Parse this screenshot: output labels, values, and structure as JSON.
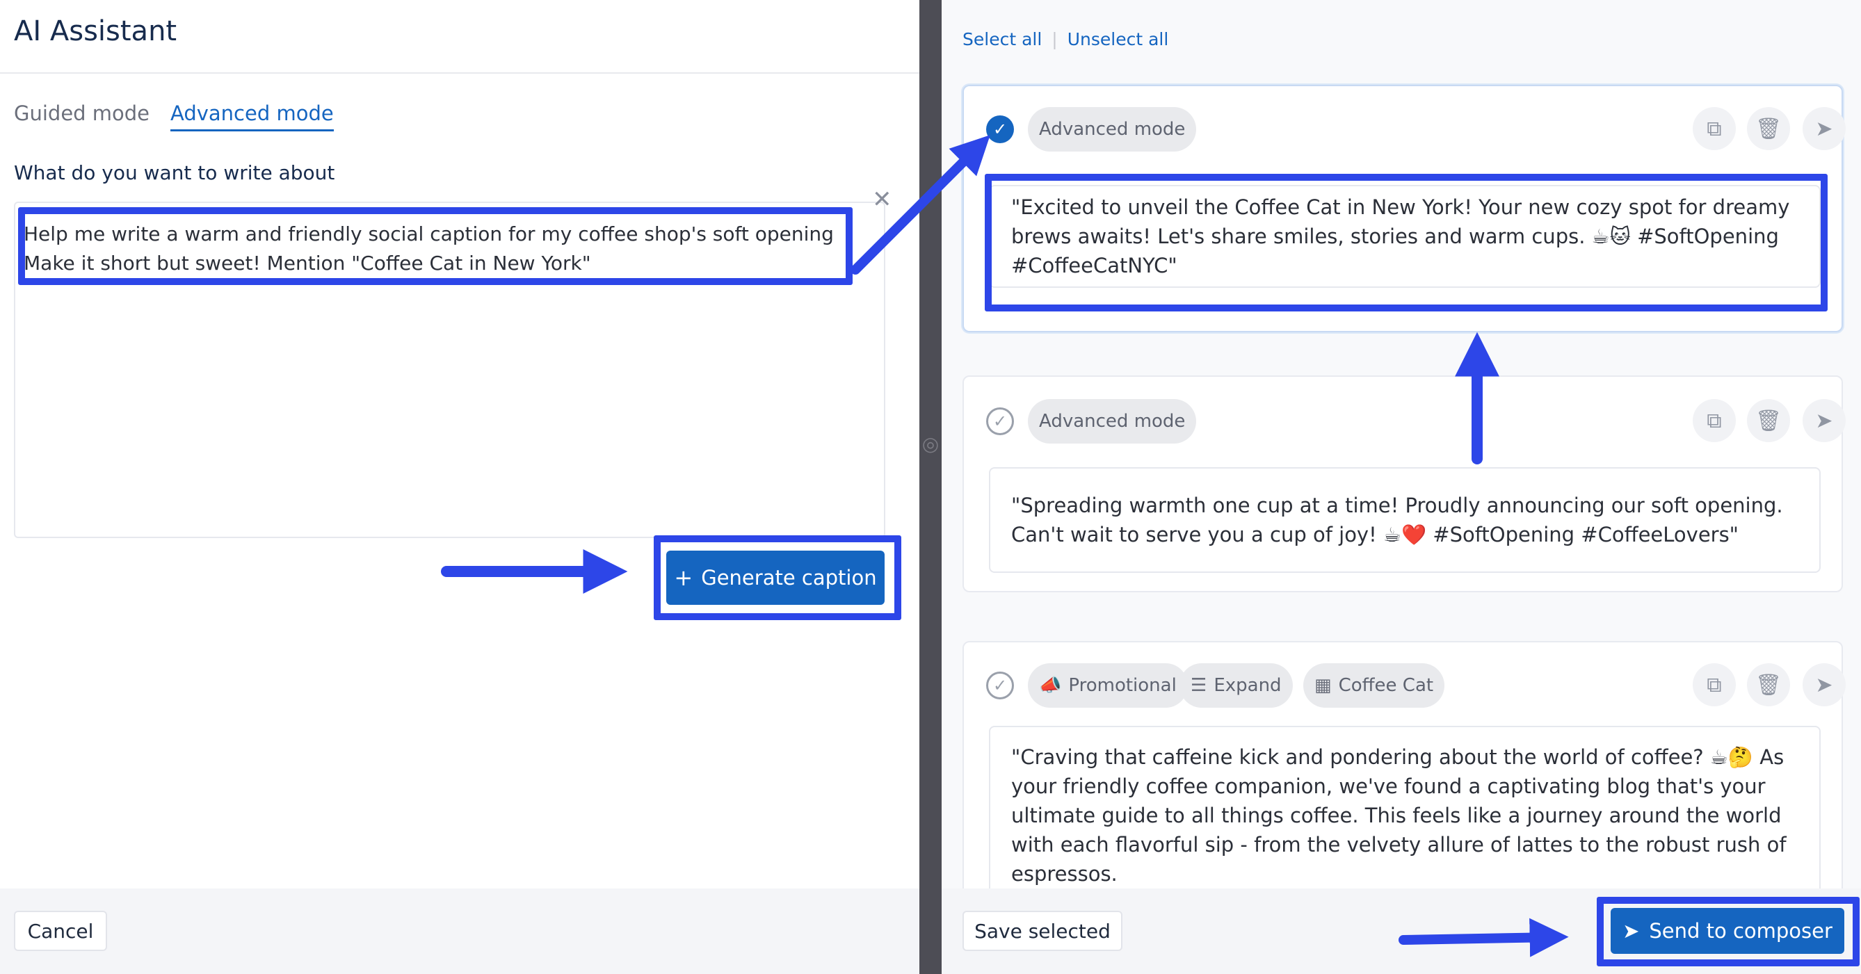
{
  "left": {
    "title": "AI Assistant",
    "tabs": [
      {
        "label": "Guided mode",
        "active": false
      },
      {
        "label": "Advanced mode",
        "active": true
      }
    ],
    "prompt_label": "What do you want to write about",
    "prompt_value": "Help me write a warm and friendly social caption for my coffee shop's soft opening Make it short but sweet! Mention \"Coffee Cat in New York\"",
    "generate_label": "Generate caption",
    "cancel_label": "Cancel"
  },
  "right": {
    "select_all": "Select all",
    "unselect_all": "Unselect all",
    "cards": [
      {
        "selected": true,
        "chips": [
          "Advanced mode"
        ],
        "caption": "\"Excited to unveil the Coffee Cat in New York! Your new cozy spot for dreamy brews awaits! Let's share smiles, stories and warm cups. ☕🐱 #SoftOpening #CoffeeCatNYC\""
      },
      {
        "selected": false,
        "chips": [
          "Advanced mode"
        ],
        "caption": "\"Spreading warmth one cup at a time! Proudly announcing our soft opening. Can't wait to serve you a cup of joy! ☕❤️ #SoftOpening #CoffeeLovers\""
      },
      {
        "selected": false,
        "chips": [
          "Promotional",
          "Expand",
          "Coffee Cat"
        ],
        "caption": "\"Craving that caffeine kick and pondering about the world of coffee? ☕🤔 As your friendly coffee companion, we've found a captivating blog that's your ultimate guide to all things coffee. This feels like a journey around the world with each flavorful sip - from the velvety allure of lattes to the robust rush of espressos."
      }
    ],
    "save_selected_label": "Save selected",
    "send_label": "Send to composer"
  },
  "icons": {
    "check": "check-icon",
    "copy": "copy-icon",
    "delete": "trash-icon",
    "send": "send-icon",
    "close": "close-icon",
    "plus": "plus-icon",
    "camera": "camera-icon",
    "megaphone": "megaphone-icon",
    "expand": "lines-icon",
    "building": "building-icon"
  },
  "colors": {
    "accent": "#1565c0",
    "annotation": "#2d46e8"
  }
}
